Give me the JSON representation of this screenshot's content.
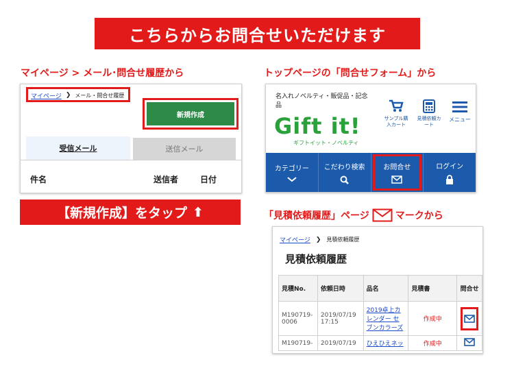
{
  "banner": {
    "title": "こちらからお問合せいただけます"
  },
  "left": {
    "heading": "マイページ > メール･問合せ履歴から",
    "breadcrumb": {
      "home": "マイページ",
      "separator": "❯",
      "current": "メール・問合せ履歴"
    },
    "new_button": "新規作成",
    "tabs": [
      {
        "label": "受信メール",
        "active": true
      },
      {
        "label": "送信メール",
        "active": false
      }
    ],
    "columns": [
      "件名",
      "送信者",
      "日付"
    ],
    "cta": {
      "text": "【新規作成】をタップ",
      "arrow": "⬆"
    }
  },
  "right_top": {
    "heading": "トップページの「問合せフォーム」から",
    "tagline": "名入れノベルティ・販促品・記念品",
    "logo": {
      "main": "Gift it!",
      "sub": "ギフトイット・ノベルティ"
    },
    "header_icons": [
      {
        "label": "サンプル購入カート",
        "icon": "cart-icon"
      },
      {
        "label": "見積依頼カート",
        "icon": "calculator-icon"
      },
      {
        "label": "メニュー",
        "icon": "menu-icon"
      }
    ],
    "nav": [
      {
        "label": "カテゴリー",
        "icon": "chevron-down-icon"
      },
      {
        "label": "こだわり検索",
        "icon": "search-icon"
      },
      {
        "label": "お問合せ",
        "icon": "mail-icon"
      },
      {
        "label": "ログイン",
        "icon": "lock-icon"
      }
    ]
  },
  "right_bottom": {
    "heading_pre": "「見積依頼履歴」ページ",
    "heading_post": "マークから",
    "breadcrumb": {
      "home": "マイページ",
      "separator": "❯",
      "current": "見積依頼履歴"
    },
    "page_title": "見積依頼履歴",
    "columns": [
      "見積No.",
      "依頼日時",
      "品名",
      "見積書",
      "問合せ"
    ],
    "rows": [
      {
        "no": "M190719-0006",
        "date": "2019/07/19 17:15",
        "item": "2019卓上カレンダー セブンカラーズ",
        "status": "作成中"
      },
      {
        "no": "M190719-",
        "date": "2019/07/19",
        "item": "ひえひえネッ",
        "status": "作成中"
      }
    ]
  },
  "colors": {
    "accent_red": "#e21a1a",
    "nav_blue": "#1c5aab",
    "button_green": "#2e8b47",
    "link_blue": "#1a49c8"
  }
}
